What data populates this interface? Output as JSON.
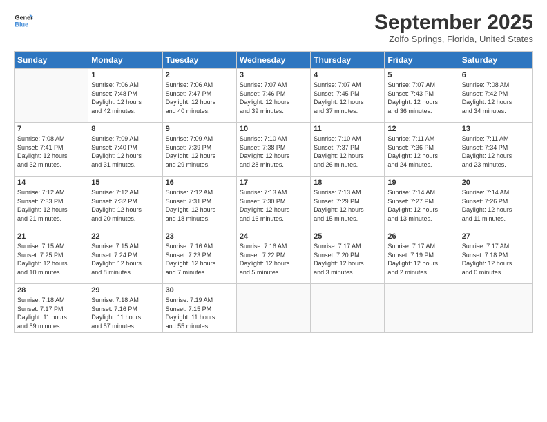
{
  "header": {
    "logo_line1": "General",
    "logo_line2": "Blue",
    "title": "September 2025",
    "subtitle": "Zolfo Springs, Florida, United States"
  },
  "days_of_week": [
    "Sunday",
    "Monday",
    "Tuesday",
    "Wednesday",
    "Thursday",
    "Friday",
    "Saturday"
  ],
  "weeks": [
    [
      {
        "day": "",
        "info": ""
      },
      {
        "day": "1",
        "info": "Sunrise: 7:06 AM\nSunset: 7:48 PM\nDaylight: 12 hours\nand 42 minutes."
      },
      {
        "day": "2",
        "info": "Sunrise: 7:06 AM\nSunset: 7:47 PM\nDaylight: 12 hours\nand 40 minutes."
      },
      {
        "day": "3",
        "info": "Sunrise: 7:07 AM\nSunset: 7:46 PM\nDaylight: 12 hours\nand 39 minutes."
      },
      {
        "day": "4",
        "info": "Sunrise: 7:07 AM\nSunset: 7:45 PM\nDaylight: 12 hours\nand 37 minutes."
      },
      {
        "day": "5",
        "info": "Sunrise: 7:07 AM\nSunset: 7:43 PM\nDaylight: 12 hours\nand 36 minutes."
      },
      {
        "day": "6",
        "info": "Sunrise: 7:08 AM\nSunset: 7:42 PM\nDaylight: 12 hours\nand 34 minutes."
      }
    ],
    [
      {
        "day": "7",
        "info": "Sunrise: 7:08 AM\nSunset: 7:41 PM\nDaylight: 12 hours\nand 32 minutes."
      },
      {
        "day": "8",
        "info": "Sunrise: 7:09 AM\nSunset: 7:40 PM\nDaylight: 12 hours\nand 31 minutes."
      },
      {
        "day": "9",
        "info": "Sunrise: 7:09 AM\nSunset: 7:39 PM\nDaylight: 12 hours\nand 29 minutes."
      },
      {
        "day": "10",
        "info": "Sunrise: 7:10 AM\nSunset: 7:38 PM\nDaylight: 12 hours\nand 28 minutes."
      },
      {
        "day": "11",
        "info": "Sunrise: 7:10 AM\nSunset: 7:37 PM\nDaylight: 12 hours\nand 26 minutes."
      },
      {
        "day": "12",
        "info": "Sunrise: 7:11 AM\nSunset: 7:36 PM\nDaylight: 12 hours\nand 24 minutes."
      },
      {
        "day": "13",
        "info": "Sunrise: 7:11 AM\nSunset: 7:34 PM\nDaylight: 12 hours\nand 23 minutes."
      }
    ],
    [
      {
        "day": "14",
        "info": "Sunrise: 7:12 AM\nSunset: 7:33 PM\nDaylight: 12 hours\nand 21 minutes."
      },
      {
        "day": "15",
        "info": "Sunrise: 7:12 AM\nSunset: 7:32 PM\nDaylight: 12 hours\nand 20 minutes."
      },
      {
        "day": "16",
        "info": "Sunrise: 7:12 AM\nSunset: 7:31 PM\nDaylight: 12 hours\nand 18 minutes."
      },
      {
        "day": "17",
        "info": "Sunrise: 7:13 AM\nSunset: 7:30 PM\nDaylight: 12 hours\nand 16 minutes."
      },
      {
        "day": "18",
        "info": "Sunrise: 7:13 AM\nSunset: 7:29 PM\nDaylight: 12 hours\nand 15 minutes."
      },
      {
        "day": "19",
        "info": "Sunrise: 7:14 AM\nSunset: 7:27 PM\nDaylight: 12 hours\nand 13 minutes."
      },
      {
        "day": "20",
        "info": "Sunrise: 7:14 AM\nSunset: 7:26 PM\nDaylight: 12 hours\nand 11 minutes."
      }
    ],
    [
      {
        "day": "21",
        "info": "Sunrise: 7:15 AM\nSunset: 7:25 PM\nDaylight: 12 hours\nand 10 minutes."
      },
      {
        "day": "22",
        "info": "Sunrise: 7:15 AM\nSunset: 7:24 PM\nDaylight: 12 hours\nand 8 minutes."
      },
      {
        "day": "23",
        "info": "Sunrise: 7:16 AM\nSunset: 7:23 PM\nDaylight: 12 hours\nand 7 minutes."
      },
      {
        "day": "24",
        "info": "Sunrise: 7:16 AM\nSunset: 7:22 PM\nDaylight: 12 hours\nand 5 minutes."
      },
      {
        "day": "25",
        "info": "Sunrise: 7:17 AM\nSunset: 7:20 PM\nDaylight: 12 hours\nand 3 minutes."
      },
      {
        "day": "26",
        "info": "Sunrise: 7:17 AM\nSunset: 7:19 PM\nDaylight: 12 hours\nand 2 minutes."
      },
      {
        "day": "27",
        "info": "Sunrise: 7:17 AM\nSunset: 7:18 PM\nDaylight: 12 hours\nand 0 minutes."
      }
    ],
    [
      {
        "day": "28",
        "info": "Sunrise: 7:18 AM\nSunset: 7:17 PM\nDaylight: 11 hours\nand 59 minutes."
      },
      {
        "day": "29",
        "info": "Sunrise: 7:18 AM\nSunset: 7:16 PM\nDaylight: 11 hours\nand 57 minutes."
      },
      {
        "day": "30",
        "info": "Sunrise: 7:19 AM\nSunset: 7:15 PM\nDaylight: 11 hours\nand 55 minutes."
      },
      {
        "day": "",
        "info": ""
      },
      {
        "day": "",
        "info": ""
      },
      {
        "day": "",
        "info": ""
      },
      {
        "day": "",
        "info": ""
      }
    ]
  ]
}
